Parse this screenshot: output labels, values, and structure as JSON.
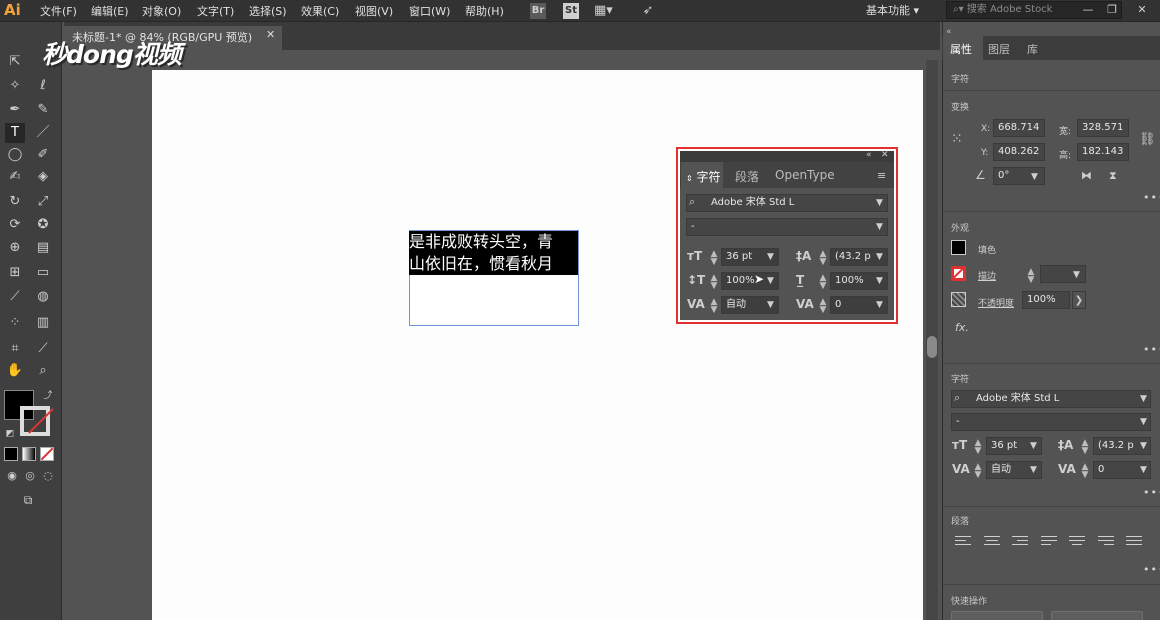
{
  "app": {
    "logo": "Ai",
    "workspace": "基本功能 ▾",
    "stock_search_placeholder": "搜索 Adobe Stock"
  },
  "menu": [
    "文件(F)",
    "编辑(E)",
    "对象(O)",
    "文字(T)",
    "选择(S)",
    "效果(C)",
    "视图(V)",
    "窗口(W)",
    "帮助(H)"
  ],
  "toolbar_icons": {
    "bridge": "Br",
    "stock": "St"
  },
  "window_controls": [
    "—",
    "❐",
    "✕"
  ],
  "document": {
    "tab_label": "未标题-1* @ 84% (RGB/GPU 预览)",
    "close": "✕"
  },
  "canvas_text": [
    "是非成败转头空，青",
    "山依旧在，惯看秋月"
  ],
  "watermark": "秒dong视频",
  "char_panel": {
    "tabs": [
      "字符",
      "段落",
      "OpenType"
    ],
    "font_family": "Adobe 宋体 Std L",
    "font_style": "-",
    "font_size": "36 pt",
    "leading": "(43.2 p",
    "vertical_scale": "100%",
    "horizontal_scale": "100%",
    "kerning": "自动",
    "tracking": "0"
  },
  "properties": {
    "tabs": [
      "属性",
      "图层",
      "库"
    ],
    "section_char_top": "字符",
    "section_transform": "变换",
    "x_label": "X:",
    "x": "668.714",
    "y_label": "Y:",
    "y": "408.262",
    "w_label": "宽:",
    "w": "328.571",
    "h_label": "高:",
    "h": "182.143",
    "rotate": "0°",
    "section_appearance": "外观",
    "fill_label": "填色",
    "stroke_label": "描边",
    "opacity_label": "不透明度",
    "opacity": "100%",
    "fx": "fx.",
    "section_char": "字符",
    "font_family": "Adobe 宋体 Std L",
    "font_style": "-",
    "font_size": "36 pt",
    "leading": "(43.2 p",
    "kerning": "自动",
    "tracking": "0",
    "section_paragraph": "段落",
    "section_quick": "快速操作"
  }
}
